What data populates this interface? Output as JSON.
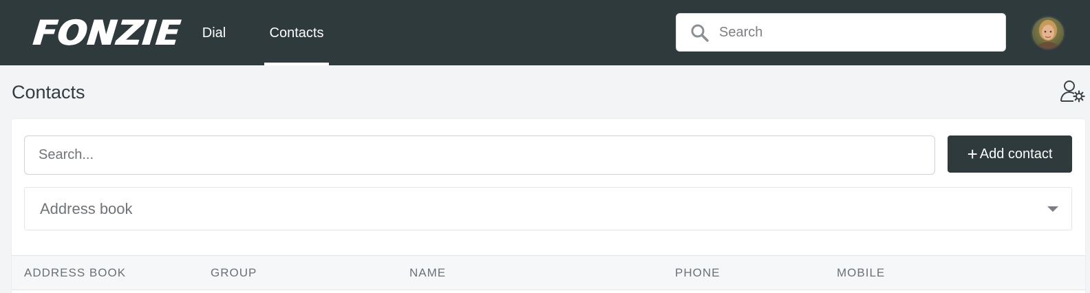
{
  "header": {
    "logo_text": "FONZIE",
    "nav": [
      {
        "label": "Dial",
        "active": false
      },
      {
        "label": "Contacts",
        "active": true
      }
    ],
    "search_placeholder": "Search",
    "avatar_icon": "user-avatar-photo"
  },
  "page": {
    "title": "Contacts",
    "settings_icon": "user-settings-icon"
  },
  "toolbar": {
    "search_placeholder": "Search...",
    "add_contact_label": "Add contact",
    "add_contact_icon": "plus-icon",
    "addressbook_select_value": "Address book"
  },
  "table": {
    "columns": [
      "ADDRESS BOOK",
      "GROUP",
      "NAME",
      "PHONE",
      "MOBILE"
    ]
  },
  "colors": {
    "topbar": "#2f3a3d",
    "page_bg": "#f3f4f6",
    "primary_button": "#2f3a3d"
  }
}
